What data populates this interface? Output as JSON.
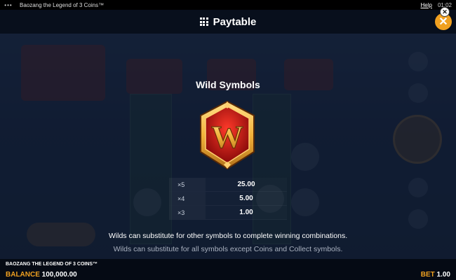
{
  "system_bar": {
    "dots": "•••",
    "title": "Baozang the Legend of 3 Coins™",
    "help": "Help",
    "clock": "01:02"
  },
  "header": {
    "title": "Paytable",
    "close_glyph": "✕",
    "mini_close_glyph": "✕"
  },
  "section": {
    "title": "Wild Symbols",
    "symbol_letter": "W",
    "symbol_icon": "wild-w-shield-icon",
    "pays": [
      {
        "multiplier": "×5",
        "value": "25.00"
      },
      {
        "multiplier": "×4",
        "value": "5.00"
      },
      {
        "multiplier": "×3",
        "value": "1.00"
      }
    ],
    "description_1": "Wilds can substitute for other symbols to complete winning combinations.",
    "description_2": "Wilds can substitute for all symbols except Coins and Collect symbols."
  },
  "footer": {
    "game_name": "BAOZANG THE LEGEND OF 3 COINS™",
    "balance_label": "BALANCE",
    "balance_value": "100,000.00",
    "bet_label": "BET",
    "bet_value": "1.00"
  },
  "colors": {
    "accent": "#f0a020",
    "symbol_red": "#c01818",
    "symbol_gold": "#f2b23a"
  }
}
